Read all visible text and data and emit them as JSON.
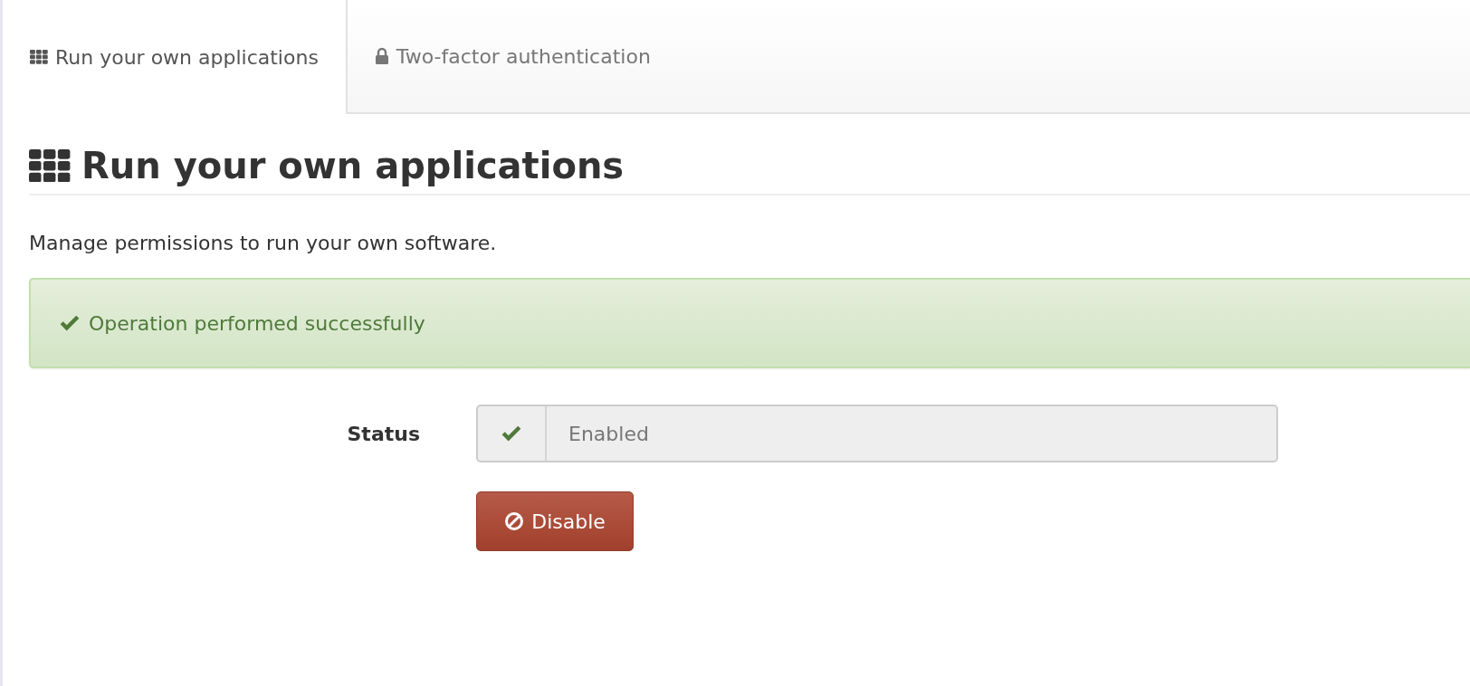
{
  "tabs": [
    {
      "label": "Run your own applications",
      "selected": true
    },
    {
      "label": "Two-factor authentication",
      "selected": false
    }
  ],
  "heading": "Run your own applications",
  "description": "Manage permissions to run your own software.",
  "alert": {
    "message": "Operation performed successfully"
  },
  "status": {
    "label": "Status",
    "value": "Enabled",
    "on": true
  },
  "action_button": "Disable"
}
